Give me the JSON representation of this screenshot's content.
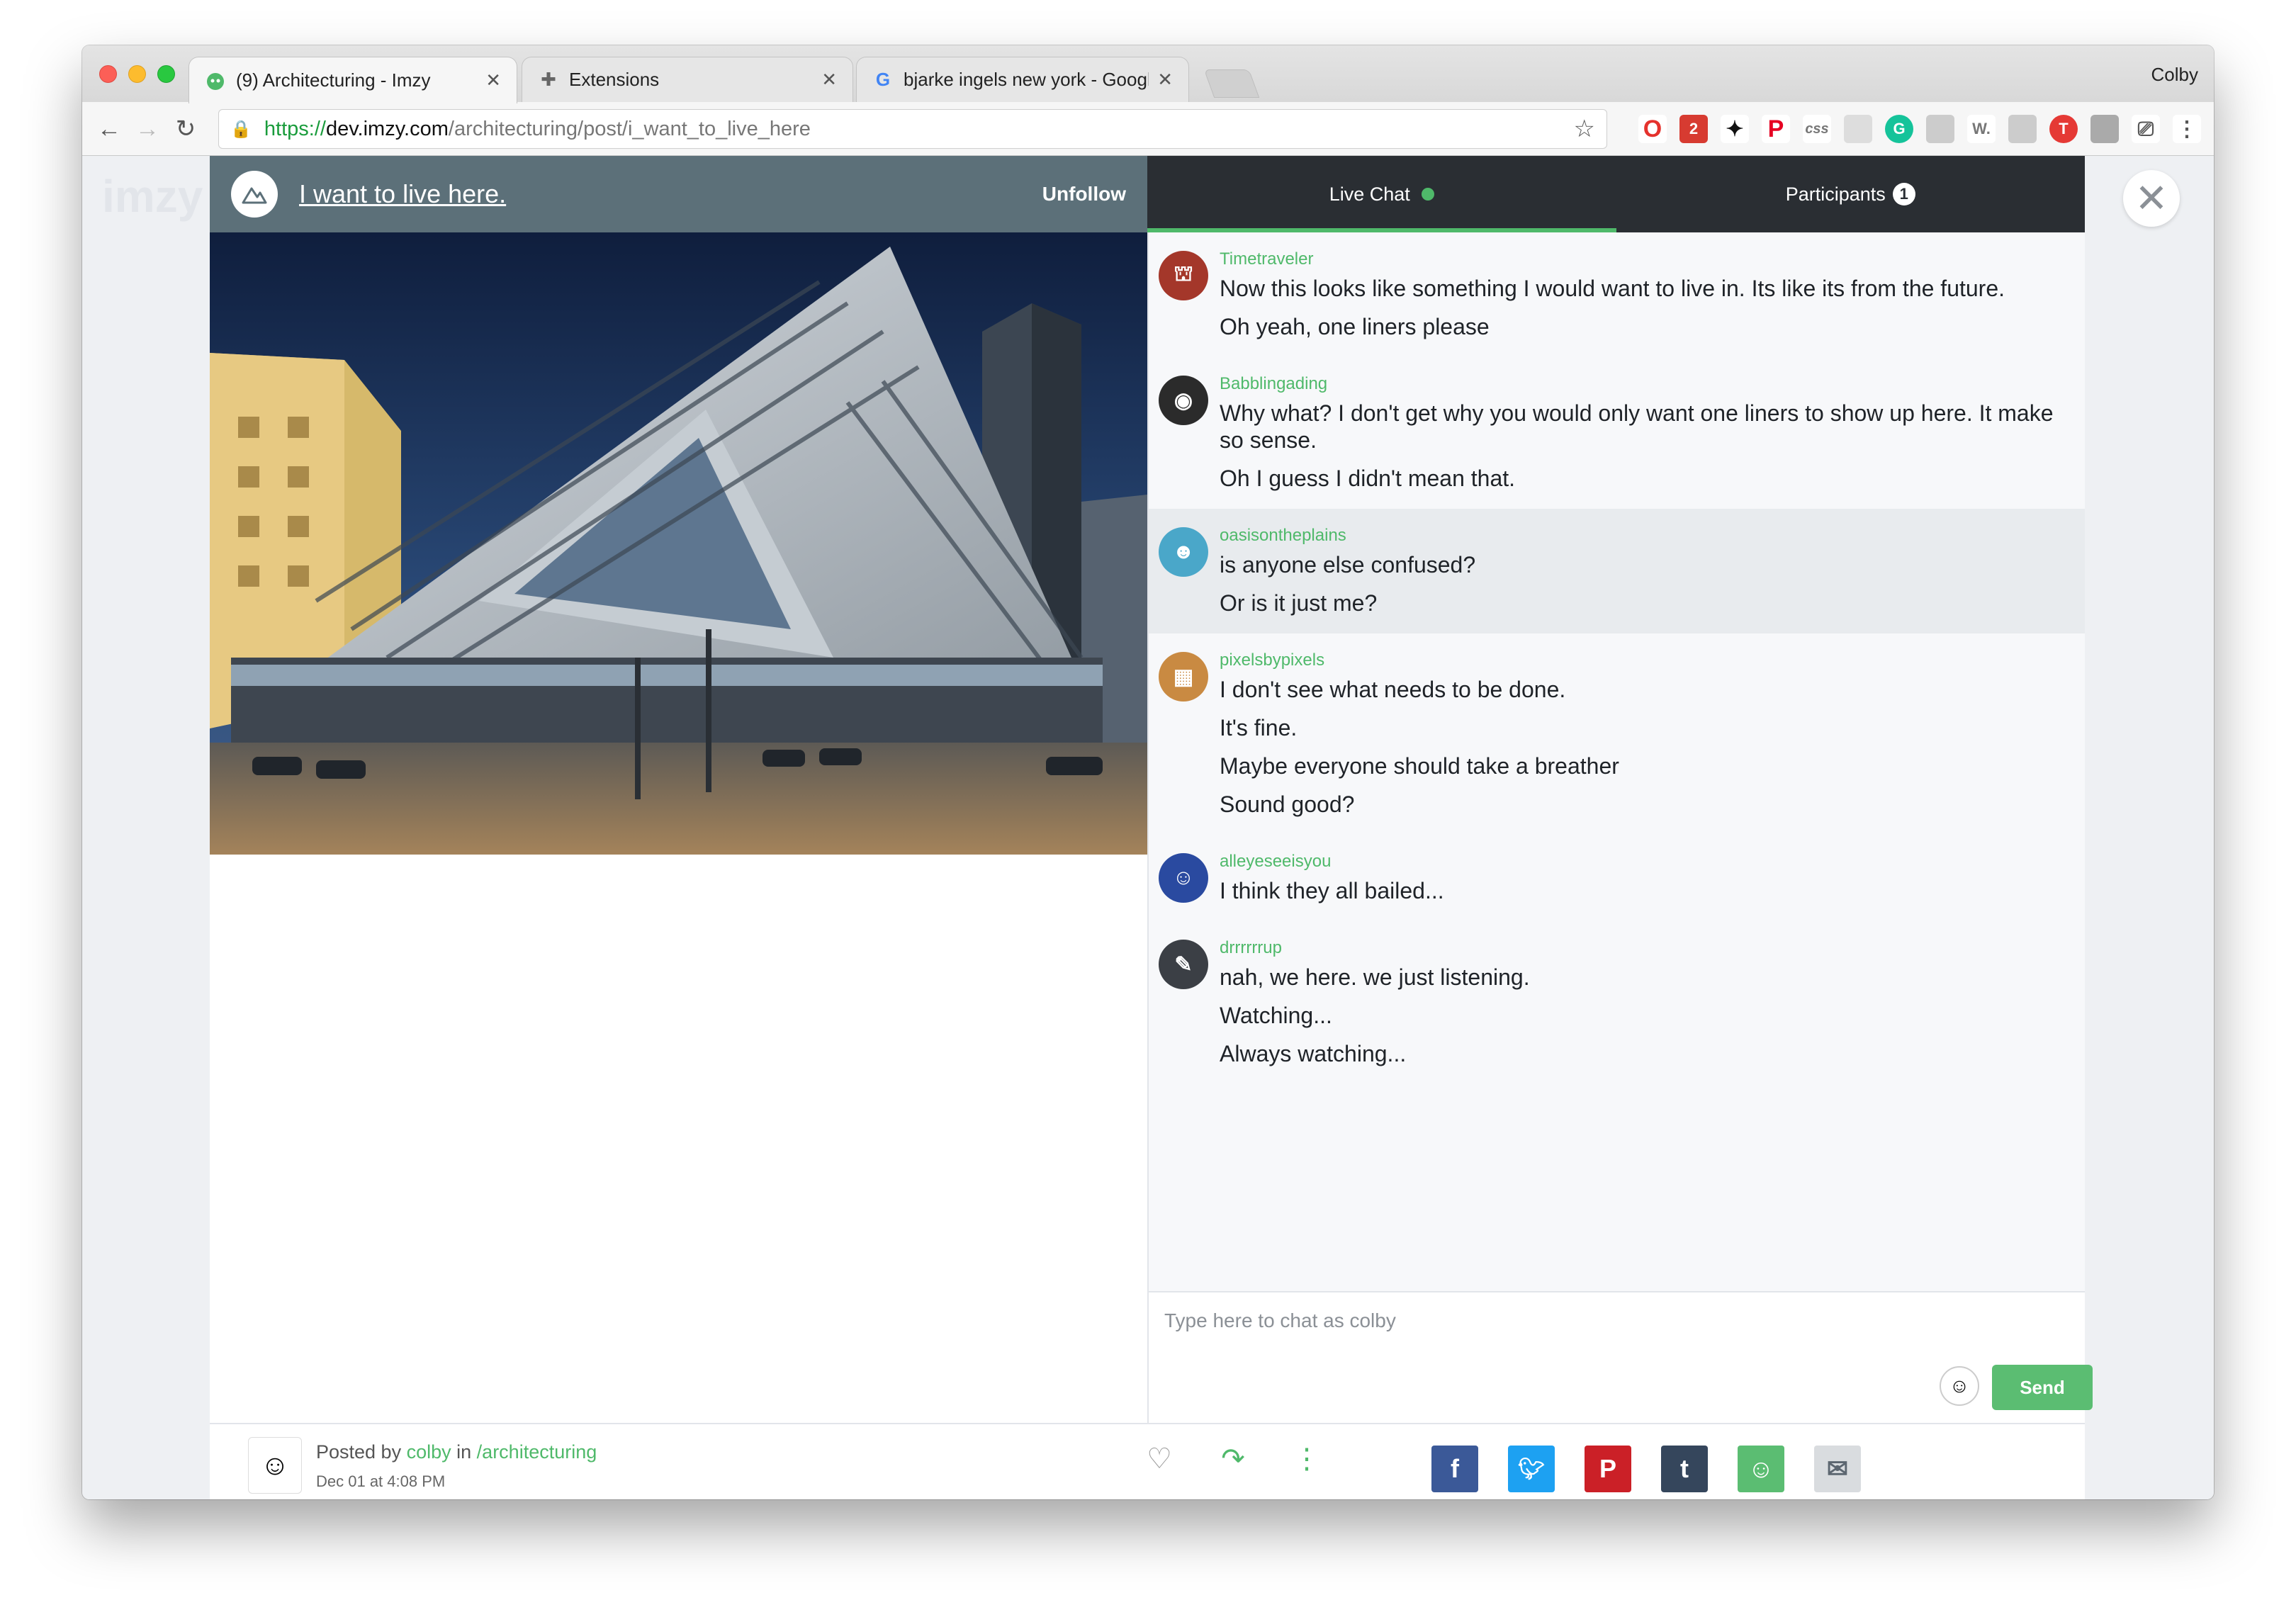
{
  "browser": {
    "tabs": [
      {
        "title": "(9) Architecturing - Imzy",
        "icon": "imzy-favicon"
      },
      {
        "title": "Extensions",
        "icon": "puzzle-icon"
      },
      {
        "title": "bjarke ingels new york - Googl",
        "icon": "google-icon"
      }
    ],
    "profile_name": "Colby",
    "url": {
      "scheme": "https://",
      "host": "dev.imzy.com",
      "path": "/architecturing/post/i_want_to_live_here"
    }
  },
  "page": {
    "ghost_logo": "imzy"
  },
  "post": {
    "title": "I want to live here.",
    "unfollow_label": "Unfollow",
    "posted_by_label": "Posted by",
    "author": "colby",
    "in_label": "in",
    "community": "/architecturing",
    "date": "Dec 01 at 4:08 PM"
  },
  "chat": {
    "tab_live": "Live Chat",
    "tab_participants": "Participants",
    "participant_count": "1",
    "messages": [
      {
        "user": "Timetraveler",
        "lines": [
          "Now this looks like something I would want to live in. Its like its from the future.",
          "Oh yeah, one liners please"
        ]
      },
      {
        "user": "Babblingading",
        "lines": [
          "Why what? I don't get why you would only want one liners to show up here. It make so sense.",
          "Oh I guess I didn't mean that."
        ]
      },
      {
        "user": "oasisontheplains",
        "lines": [
          "is anyone else confused?",
          "Or is it just me?"
        ]
      },
      {
        "user": "pixelsbypixels",
        "lines": [
          "I don't see what needs to be done.",
          "It's fine.",
          "Maybe everyone should take a breather",
          "Sound good?"
        ]
      },
      {
        "user": "alleyeseeisyou",
        "lines": [
          "I think they all bailed..."
        ]
      },
      {
        "user": "drrrrrrup",
        "lines": [
          "nah, we here. we just listening.",
          "Watching...",
          "Always watching..."
        ]
      }
    ],
    "composer_placeholder": "Type here to chat as colby",
    "send_label": "Send"
  },
  "colors": {
    "accent": "#4fb96a",
    "header_bg": "#5c7079",
    "chat_header_bg": "#2a2e33"
  }
}
